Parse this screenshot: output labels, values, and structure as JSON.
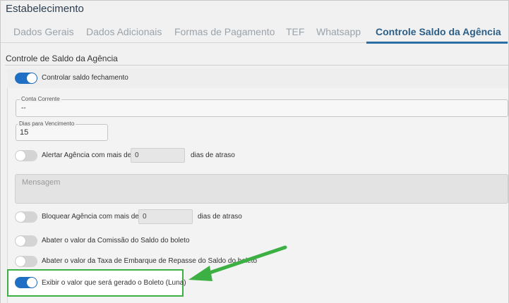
{
  "window": {
    "title": "Estabelecimento"
  },
  "tabs": [
    {
      "label": "Dados Gerais",
      "active": false
    },
    {
      "label": "Dados Adicionais",
      "active": false
    },
    {
      "label": "Formas de Pagamento",
      "active": false
    },
    {
      "label": "TEF",
      "active": false
    },
    {
      "label": "Whatsapp",
      "active": false
    },
    {
      "label": "Controle Saldo da Agência",
      "active": true
    }
  ],
  "section": {
    "title": "Controle de Saldo da Agência"
  },
  "controlar_saldo": {
    "label": "Controlar saldo fechamento",
    "enabled": true
  },
  "conta_corrente": {
    "legend": "Conta Corrente",
    "value": "--"
  },
  "dias_vencimento": {
    "legend": "Dias para Vencimento",
    "value": "15"
  },
  "alertar": {
    "label": "Alertar Agência com mais de",
    "value": "0",
    "suffix": "dias de atraso",
    "enabled": false
  },
  "mensagem": {
    "placeholder": "Mensagem"
  },
  "bloquear": {
    "label": "Bloquear Agência com mais de",
    "value": "0",
    "suffix": "dias de atraso",
    "enabled": false
  },
  "abater_comissao": {
    "label": "Abater o valor da Comissão do Saldo do boleto",
    "enabled": false
  },
  "abater_taxa": {
    "label": "Abater o valor da Taxa de Embarque de Repasse do Saldo do boleto",
    "enabled": false
  },
  "exibir_valor": {
    "label": "Exibir o valor que será gerado o Boleto (Luna)",
    "enabled": true
  },
  "colors": {
    "accent": "#1f6fc5",
    "highlight": "#3cb043",
    "tab_active": "#2c5f88"
  }
}
